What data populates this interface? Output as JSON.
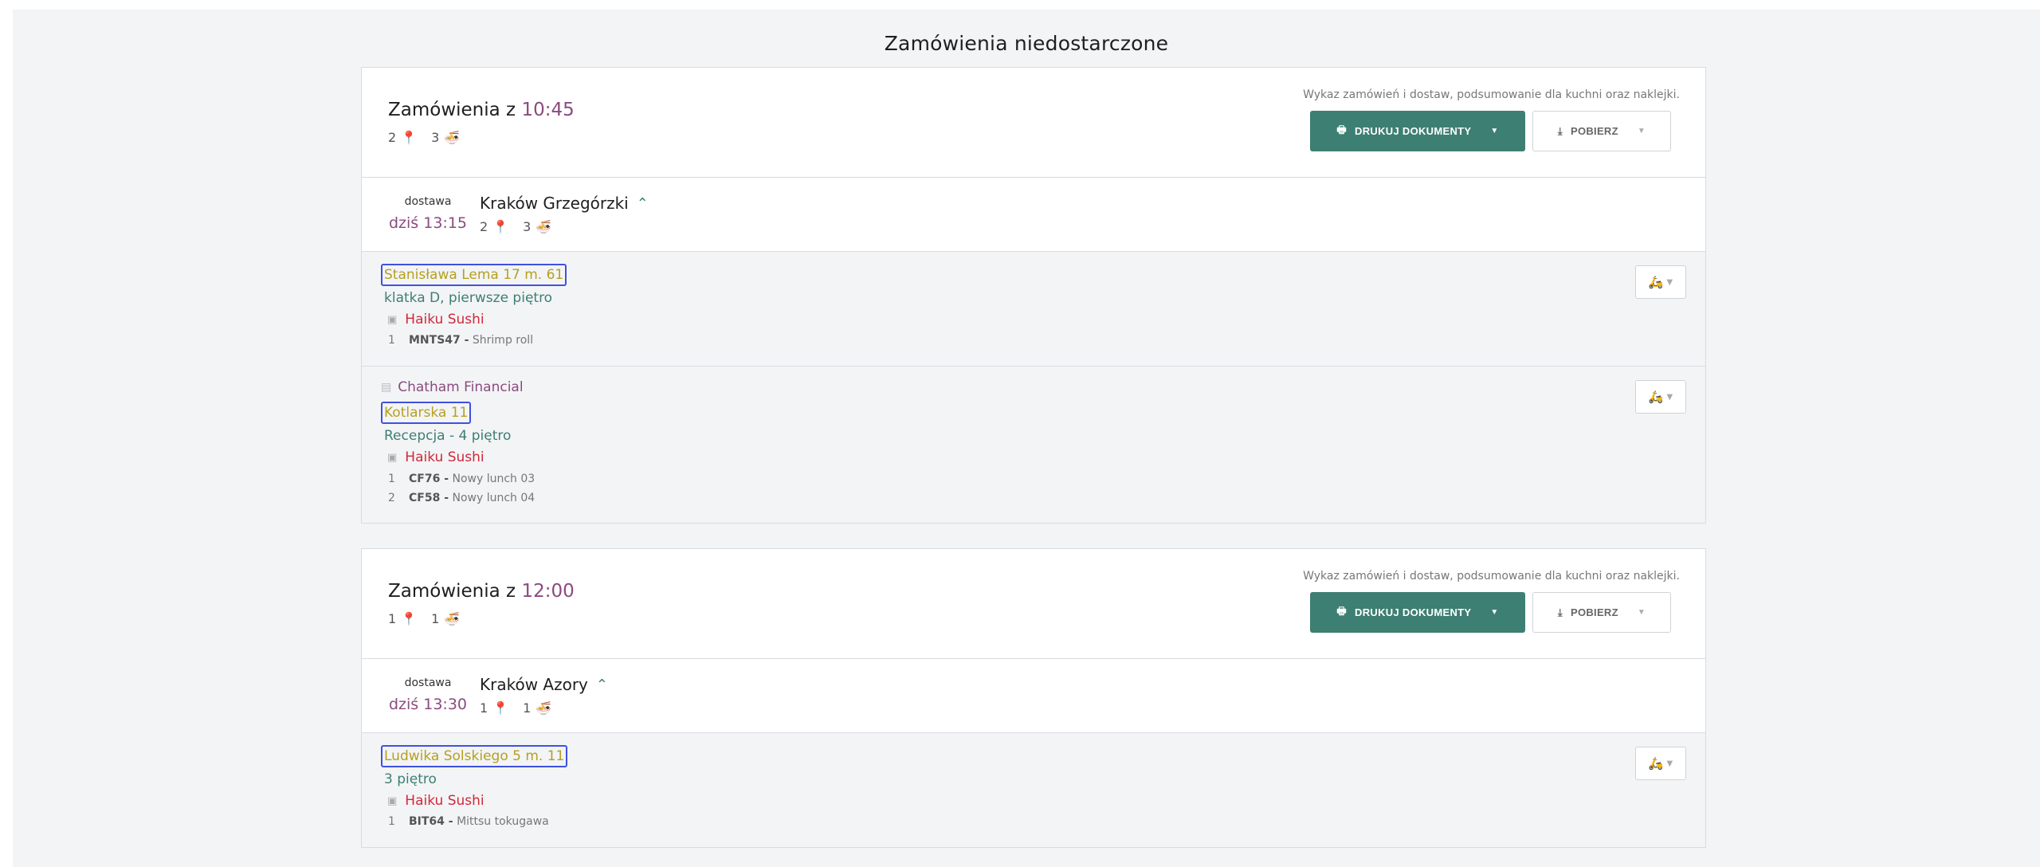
{
  "page": {
    "title": "Zamówienia niedostarczone"
  },
  "batches": [
    {
      "title_prefix": "Zamówienia z",
      "time": "10:45",
      "count_locations": "2",
      "count_meals": "3",
      "description": "Wykaz zamówień i dostaw, podsumowanie dla kuchni oraz naklejki.",
      "print_label": "DRUKUJ DOKUMENTY",
      "download_label": "POBIERZ",
      "route": {
        "kind": "dostawa",
        "time": "dziś 13:15",
        "name": "Kraków Grzegórzki",
        "count_locations": "2",
        "count_meals": "3",
        "stops": [
          {
            "address": "Stanisława Lema 17 m. 61",
            "note": "klatka D, pierwsze piętro",
            "restaurant": "Haiku Sushi",
            "items": [
              {
                "qty": "1",
                "code": "MNTS47 -",
                "name": "Shrimp roll"
              }
            ]
          },
          {
            "company": "Chatham Financial",
            "address": "Kotlarska 11",
            "note": "Recepcja - 4 piętro",
            "restaurant": "Haiku Sushi",
            "items": [
              {
                "qty": "1",
                "code": "CF76 -",
                "name": "Nowy lunch 03"
              },
              {
                "qty": "2",
                "code": "CF58 -",
                "name": "Nowy lunch 04"
              }
            ]
          }
        ]
      }
    },
    {
      "title_prefix": "Zamówienia z",
      "time": "12:00",
      "count_locations": "1",
      "count_meals": "1",
      "description": "Wykaz zamówień i dostaw, podsumowanie dla kuchni oraz naklejki.",
      "print_label": "DRUKUJ DOKUMENTY",
      "download_label": "POBIERZ",
      "route": {
        "kind": "dostawa",
        "time": "dziś 13:30",
        "name": "Kraków Azory",
        "count_locations": "1",
        "count_meals": "1",
        "stops": [
          {
            "address": "Ludwika Solskiego 5 m. 11",
            "note": "3 piętro",
            "restaurant": "Haiku Sushi",
            "items": [
              {
                "qty": "1",
                "code": "BIT64 -",
                "name": "Mittsu tokugawa"
              }
            ]
          }
        ]
      }
    }
  ],
  "icons": {
    "location": "map-pin-icon",
    "meal": "bowl-icon",
    "printer": "printer-icon",
    "download": "download-icon",
    "chevron_up": "chevron-up-icon",
    "shop": "shop-icon",
    "building": "building-icon",
    "courier": "scooter-icon"
  },
  "colors": {
    "accent": "#3d7f72",
    "time": "#8a4b7e",
    "restaurant": "#d0293a",
    "address": "#b5a020",
    "address_outline": "#3f51e0"
  }
}
